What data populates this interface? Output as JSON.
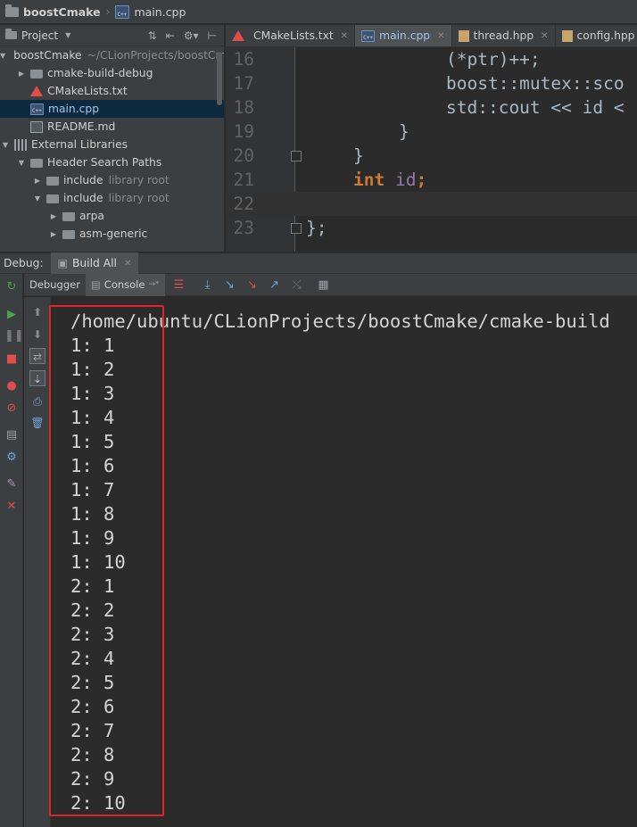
{
  "breadcrumb": {
    "project": "boostCmake",
    "file": "main.cpp"
  },
  "project_panel": {
    "title": "Project",
    "tree": [
      {
        "label": "boostCmake",
        "hint": "~/CLionProjects/boostCm",
        "expanded": true,
        "icon": "folder-icon"
      },
      {
        "label": "cmake-build-debug",
        "hint": "",
        "expanded": false,
        "icon": "folder-icon"
      },
      {
        "label": "CMakeLists.txt",
        "hint": "",
        "icon": "cmake-icon"
      },
      {
        "label": "main.cpp",
        "hint": "",
        "icon": "cpp-icon",
        "selected": true
      },
      {
        "label": "README.md",
        "hint": "",
        "icon": "markdown-icon"
      },
      {
        "label": "External Libraries",
        "hint": "",
        "expanded": true,
        "icon": "library-icon"
      },
      {
        "label": "Header Search Paths",
        "hint": "",
        "expanded": true,
        "icon": "folder-icon"
      },
      {
        "label": "include",
        "hint": "library root",
        "expanded": false,
        "icon": "folder-icon"
      },
      {
        "label": "include",
        "hint": "library root",
        "expanded": true,
        "icon": "folder-icon"
      },
      {
        "label": "arpa",
        "hint": "",
        "expanded": false,
        "icon": "folder-icon"
      },
      {
        "label": "asm-generic",
        "hint": "",
        "expanded": false,
        "icon": "folder-icon"
      }
    ]
  },
  "editor": {
    "tabs": [
      {
        "label": "CMakeLists.txt",
        "icon": "cmake-icon",
        "active": false
      },
      {
        "label": "main.cpp",
        "icon": "cpp-icon",
        "active": true
      },
      {
        "label": "thread.hpp",
        "icon": "header-file-icon",
        "active": false
      },
      {
        "label": "config.hpp",
        "icon": "header-file-icon",
        "active": false
      }
    ],
    "lines": [
      {
        "num": "16",
        "text": "(*ptr)++;"
      },
      {
        "num": "17",
        "text": "boost::mutex::sco"
      },
      {
        "num": "18",
        "text": "std::cout << id <"
      },
      {
        "num": "19",
        "text": "}"
      },
      {
        "num": "20",
        "text": "}"
      },
      {
        "num": "21",
        "text": "int id;"
      },
      {
        "num": "22",
        "text": ""
      },
      {
        "num": "23",
        "text": "};"
      }
    ]
  },
  "debug": {
    "label": "Debug:",
    "config_tab": "Build All",
    "tabs": {
      "debugger": "Debugger",
      "console": "Console"
    }
  },
  "console": {
    "lines": [
      "/home/ubuntu/CLionProjects/boostCmake/cmake-build",
      "1: 1",
      "1: 2",
      "1: 3",
      "1: 4",
      "1: 5",
      "1: 6",
      "1: 7",
      "1: 8",
      "1: 9",
      "1: 10",
      "2: 1",
      "2: 2",
      "2: 3",
      "2: 4",
      "2: 5",
      "2: 6",
      "2: 7",
      "2: 8",
      "2: 9",
      "2: 10"
    ]
  },
  "colors": {
    "highlight_box": "#e0252a",
    "selection": "#0d293e",
    "keyword": "#cc7832",
    "field": "#9876aa"
  }
}
